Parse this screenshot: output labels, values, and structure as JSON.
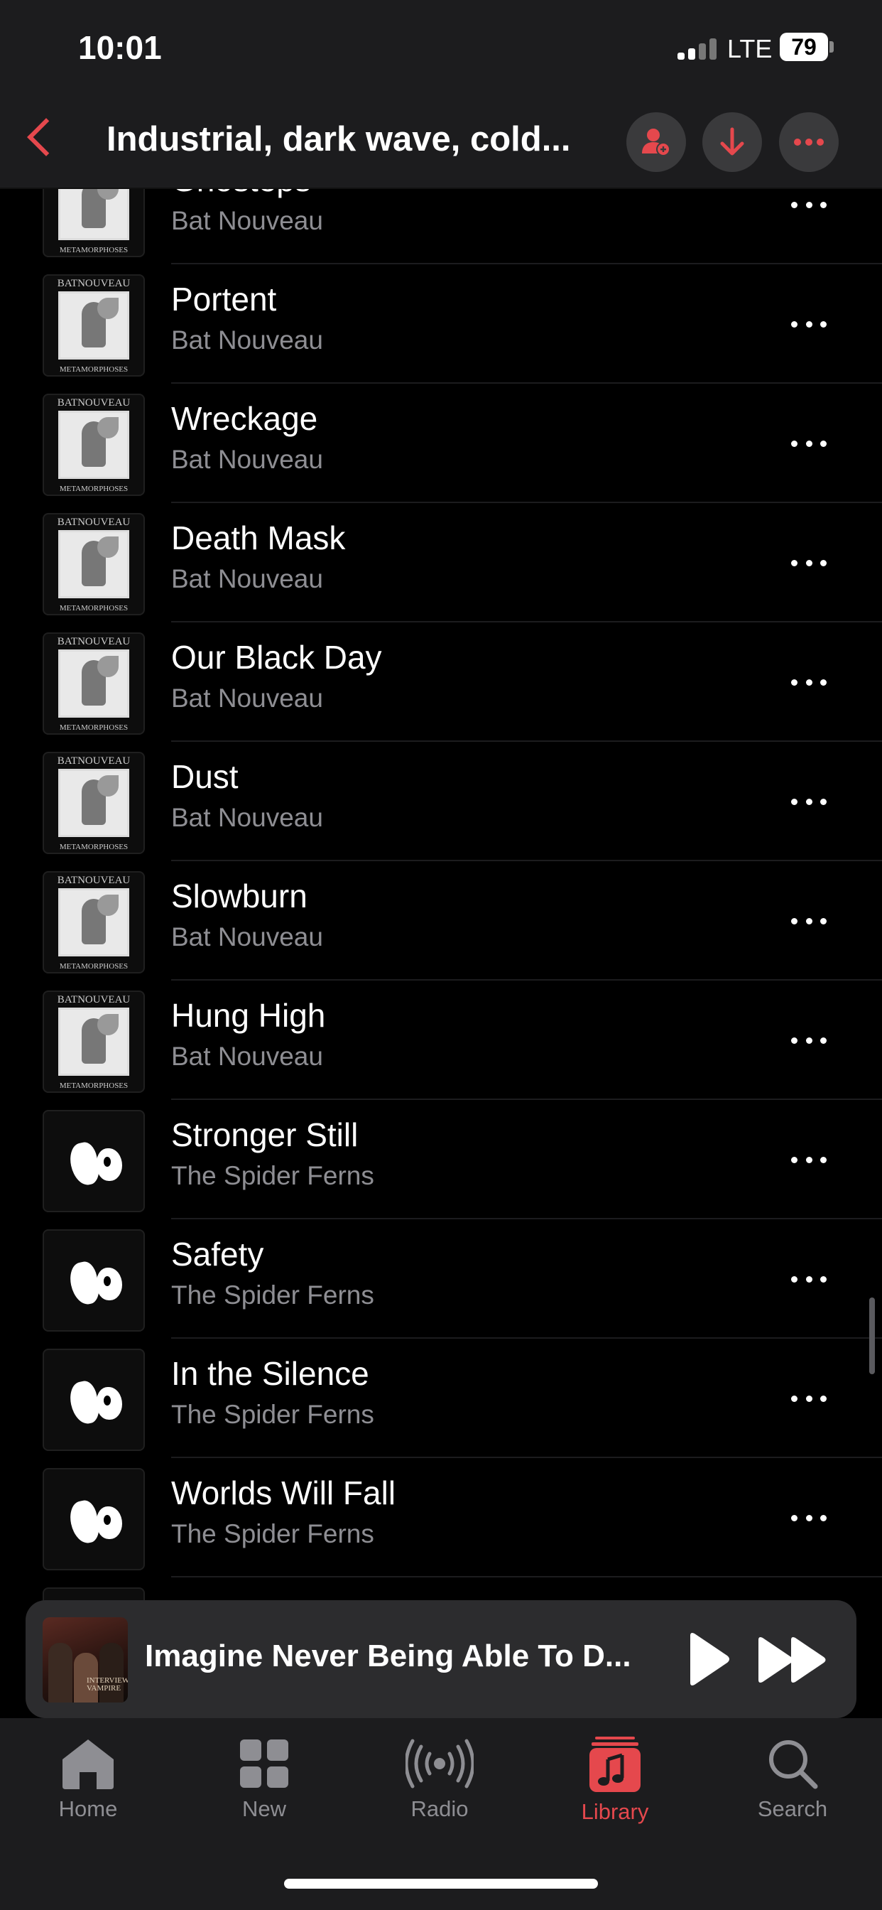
{
  "status_bar": {
    "time": "10:01",
    "network": "LTE",
    "battery": "79"
  },
  "header": {
    "title": "Industrial, dark wave, cold...",
    "accent_color": "#e5484d"
  },
  "songs": [
    {
      "title": "Ghosteps",
      "artist": "Bat Nouveau",
      "art": "bat"
    },
    {
      "title": "Portent",
      "artist": "Bat Nouveau",
      "art": "bat"
    },
    {
      "title": "Wreckage",
      "artist": "Bat Nouveau",
      "art": "bat"
    },
    {
      "title": "Death Mask",
      "artist": "Bat Nouveau",
      "art": "bat"
    },
    {
      "title": "Our Black Day",
      "artist": "Bat Nouveau",
      "art": "bat"
    },
    {
      "title": "Dust",
      "artist": "Bat Nouveau",
      "art": "bat"
    },
    {
      "title": "Slowburn",
      "artist": "Bat Nouveau",
      "art": "bat"
    },
    {
      "title": "Hung High",
      "artist": "Bat Nouveau",
      "art": "bat"
    },
    {
      "title": "Stronger Still",
      "artist": "The Spider Ferns",
      "art": "spider"
    },
    {
      "title": "Safety",
      "artist": "The Spider Ferns",
      "art": "spider"
    },
    {
      "title": "In the Silence",
      "artist": "The Spider Ferns",
      "art": "spider"
    },
    {
      "title": "Worlds Will Fall",
      "artist": "The Spider Ferns",
      "art": "spider"
    }
  ],
  "album_art_text": {
    "bat_top": "BATNOUVEAU",
    "bat_bottom": "METAMORPHOSES",
    "mini_player": "INTERVIEW VAMPIRE"
  },
  "now_playing": {
    "title": "Imagine Never Being Able To D..."
  },
  "tabs": [
    {
      "label": "Home",
      "icon": "house-icon",
      "active": false
    },
    {
      "label": "New",
      "icon": "grid-icon",
      "active": false
    },
    {
      "label": "Radio",
      "icon": "radio-waves-icon",
      "active": false
    },
    {
      "label": "Library",
      "icon": "music-note-icon",
      "active": true
    },
    {
      "label": "Search",
      "icon": "search-icon",
      "active": false
    }
  ]
}
